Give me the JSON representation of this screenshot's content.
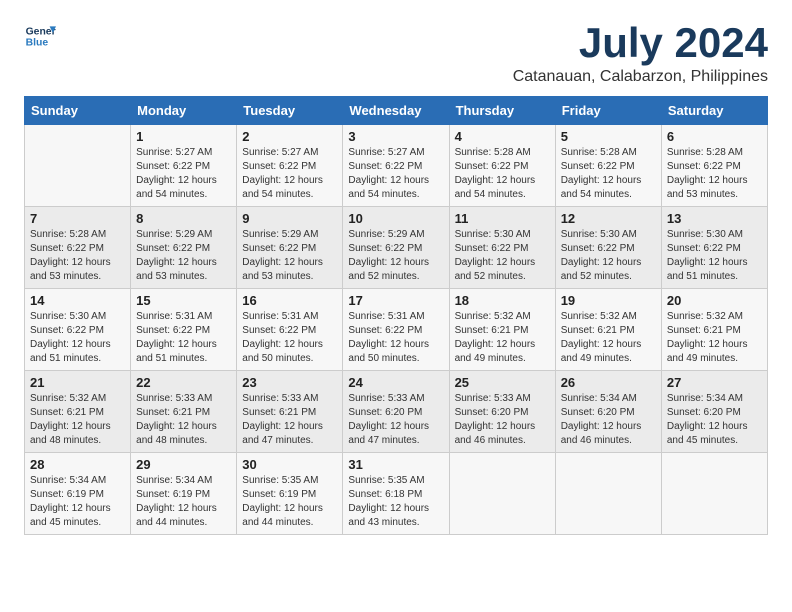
{
  "logo": {
    "line1": "General",
    "line2": "Blue"
  },
  "title": "July 2024",
  "location": "Catanauan, Calabarzon, Philippines",
  "days_of_week": [
    "Sunday",
    "Monday",
    "Tuesday",
    "Wednesday",
    "Thursday",
    "Friday",
    "Saturday"
  ],
  "weeks": [
    [
      {
        "day": "",
        "sunrise": "",
        "sunset": "",
        "daylight": ""
      },
      {
        "day": "1",
        "sunrise": "Sunrise: 5:27 AM",
        "sunset": "Sunset: 6:22 PM",
        "daylight": "Daylight: 12 hours and 54 minutes."
      },
      {
        "day": "2",
        "sunrise": "Sunrise: 5:27 AM",
        "sunset": "Sunset: 6:22 PM",
        "daylight": "Daylight: 12 hours and 54 minutes."
      },
      {
        "day": "3",
        "sunrise": "Sunrise: 5:27 AM",
        "sunset": "Sunset: 6:22 PM",
        "daylight": "Daylight: 12 hours and 54 minutes."
      },
      {
        "day": "4",
        "sunrise": "Sunrise: 5:28 AM",
        "sunset": "Sunset: 6:22 PM",
        "daylight": "Daylight: 12 hours and 54 minutes."
      },
      {
        "day": "5",
        "sunrise": "Sunrise: 5:28 AM",
        "sunset": "Sunset: 6:22 PM",
        "daylight": "Daylight: 12 hours and 54 minutes."
      },
      {
        "day": "6",
        "sunrise": "Sunrise: 5:28 AM",
        "sunset": "Sunset: 6:22 PM",
        "daylight": "Daylight: 12 hours and 53 minutes."
      }
    ],
    [
      {
        "day": "7",
        "sunrise": "Sunrise: 5:28 AM",
        "sunset": "Sunset: 6:22 PM",
        "daylight": "Daylight: 12 hours and 53 minutes."
      },
      {
        "day": "8",
        "sunrise": "Sunrise: 5:29 AM",
        "sunset": "Sunset: 6:22 PM",
        "daylight": "Daylight: 12 hours and 53 minutes."
      },
      {
        "day": "9",
        "sunrise": "Sunrise: 5:29 AM",
        "sunset": "Sunset: 6:22 PM",
        "daylight": "Daylight: 12 hours and 53 minutes."
      },
      {
        "day": "10",
        "sunrise": "Sunrise: 5:29 AM",
        "sunset": "Sunset: 6:22 PM",
        "daylight": "Daylight: 12 hours and 52 minutes."
      },
      {
        "day": "11",
        "sunrise": "Sunrise: 5:30 AM",
        "sunset": "Sunset: 6:22 PM",
        "daylight": "Daylight: 12 hours and 52 minutes."
      },
      {
        "day": "12",
        "sunrise": "Sunrise: 5:30 AM",
        "sunset": "Sunset: 6:22 PM",
        "daylight": "Daylight: 12 hours and 52 minutes."
      },
      {
        "day": "13",
        "sunrise": "Sunrise: 5:30 AM",
        "sunset": "Sunset: 6:22 PM",
        "daylight": "Daylight: 12 hours and 51 minutes."
      }
    ],
    [
      {
        "day": "14",
        "sunrise": "Sunrise: 5:30 AM",
        "sunset": "Sunset: 6:22 PM",
        "daylight": "Daylight: 12 hours and 51 minutes."
      },
      {
        "day": "15",
        "sunrise": "Sunrise: 5:31 AM",
        "sunset": "Sunset: 6:22 PM",
        "daylight": "Daylight: 12 hours and 51 minutes."
      },
      {
        "day": "16",
        "sunrise": "Sunrise: 5:31 AM",
        "sunset": "Sunset: 6:22 PM",
        "daylight": "Daylight: 12 hours and 50 minutes."
      },
      {
        "day": "17",
        "sunrise": "Sunrise: 5:31 AM",
        "sunset": "Sunset: 6:22 PM",
        "daylight": "Daylight: 12 hours and 50 minutes."
      },
      {
        "day": "18",
        "sunrise": "Sunrise: 5:32 AM",
        "sunset": "Sunset: 6:21 PM",
        "daylight": "Daylight: 12 hours and 49 minutes."
      },
      {
        "day": "19",
        "sunrise": "Sunrise: 5:32 AM",
        "sunset": "Sunset: 6:21 PM",
        "daylight": "Daylight: 12 hours and 49 minutes."
      },
      {
        "day": "20",
        "sunrise": "Sunrise: 5:32 AM",
        "sunset": "Sunset: 6:21 PM",
        "daylight": "Daylight: 12 hours and 49 minutes."
      }
    ],
    [
      {
        "day": "21",
        "sunrise": "Sunrise: 5:32 AM",
        "sunset": "Sunset: 6:21 PM",
        "daylight": "Daylight: 12 hours and 48 minutes."
      },
      {
        "day": "22",
        "sunrise": "Sunrise: 5:33 AM",
        "sunset": "Sunset: 6:21 PM",
        "daylight": "Daylight: 12 hours and 48 minutes."
      },
      {
        "day": "23",
        "sunrise": "Sunrise: 5:33 AM",
        "sunset": "Sunset: 6:21 PM",
        "daylight": "Daylight: 12 hours and 47 minutes."
      },
      {
        "day": "24",
        "sunrise": "Sunrise: 5:33 AM",
        "sunset": "Sunset: 6:20 PM",
        "daylight": "Daylight: 12 hours and 47 minutes."
      },
      {
        "day": "25",
        "sunrise": "Sunrise: 5:33 AM",
        "sunset": "Sunset: 6:20 PM",
        "daylight": "Daylight: 12 hours and 46 minutes."
      },
      {
        "day": "26",
        "sunrise": "Sunrise: 5:34 AM",
        "sunset": "Sunset: 6:20 PM",
        "daylight": "Daylight: 12 hours and 46 minutes."
      },
      {
        "day": "27",
        "sunrise": "Sunrise: 5:34 AM",
        "sunset": "Sunset: 6:20 PM",
        "daylight": "Daylight: 12 hours and 45 minutes."
      }
    ],
    [
      {
        "day": "28",
        "sunrise": "Sunrise: 5:34 AM",
        "sunset": "Sunset: 6:19 PM",
        "daylight": "Daylight: 12 hours and 45 minutes."
      },
      {
        "day": "29",
        "sunrise": "Sunrise: 5:34 AM",
        "sunset": "Sunset: 6:19 PM",
        "daylight": "Daylight: 12 hours and 44 minutes."
      },
      {
        "day": "30",
        "sunrise": "Sunrise: 5:35 AM",
        "sunset": "Sunset: 6:19 PM",
        "daylight": "Daylight: 12 hours and 44 minutes."
      },
      {
        "day": "31",
        "sunrise": "Sunrise: 5:35 AM",
        "sunset": "Sunset: 6:18 PM",
        "daylight": "Daylight: 12 hours and 43 minutes."
      },
      {
        "day": "",
        "sunrise": "",
        "sunset": "",
        "daylight": ""
      },
      {
        "day": "",
        "sunrise": "",
        "sunset": "",
        "daylight": ""
      },
      {
        "day": "",
        "sunrise": "",
        "sunset": "",
        "daylight": ""
      }
    ]
  ]
}
